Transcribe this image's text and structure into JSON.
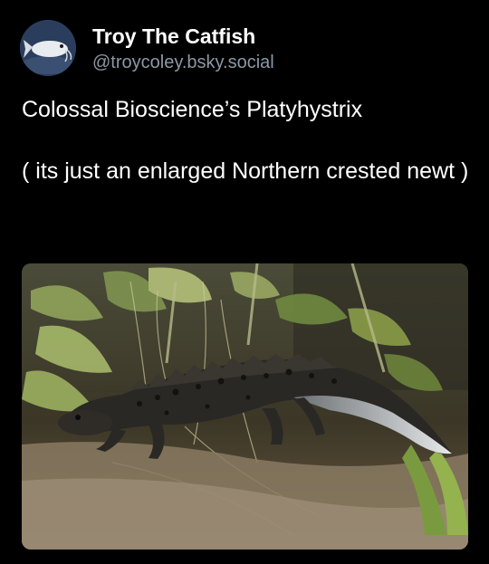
{
  "post": {
    "author": {
      "display_name": "Troy The Catfish",
      "handle": "@troycoley.bsky.social",
      "avatar_icon": "catfish-avatar-icon"
    },
    "text": {
      "line1": "Colossal Bioscience’s Platyhystrix",
      "line2": "( its just an enlarged Northern crested newt )"
    },
    "media": {
      "subject_icon": "crested-newt-photo"
    },
    "colors": {
      "background": "#000000",
      "text": "#ffffff",
      "handle": "#8b98a5"
    }
  }
}
